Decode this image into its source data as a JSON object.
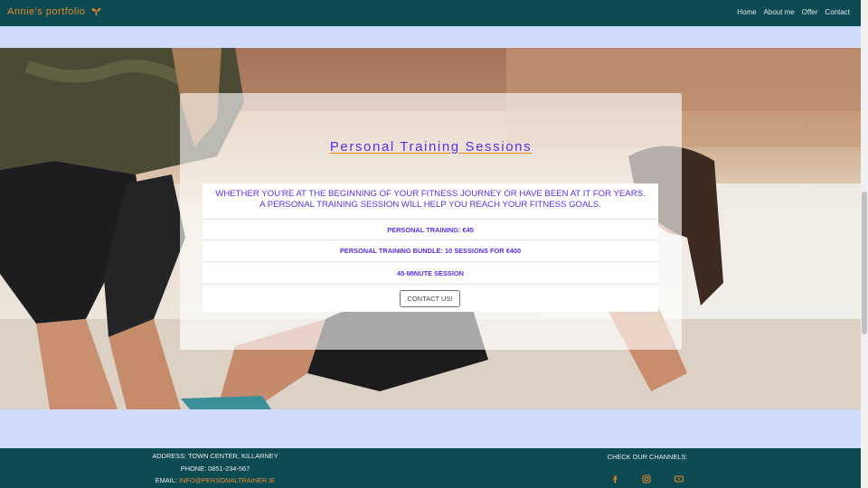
{
  "navbar": {
    "brand": "Annie's portfolio",
    "brand_icon": "seedling-icon",
    "links": [
      "Home",
      "About me",
      "Offer",
      "Contact"
    ]
  },
  "hero": {
    "image": "two-women-stretching-outdoors-photo",
    "title": "Personal Training Sessions",
    "intro": "Whether you're at the beginning of your fitness journey or have been at it for years. A personal training session will help you reach your fitness goals.",
    "items": [
      "PERSONAL TRAINING: €45",
      "PERSONAL TRAINING BUNDLE: 10 SESSIONS FOR €400",
      "45-MINUTE SESSION"
    ],
    "cta": "CONTACT US!"
  },
  "footer": {
    "address": "Address: Town Center, Killarney",
    "phone": "Phone: 0851-234-567",
    "email_label": "Email:",
    "email": "info@personaltrainer.ie",
    "channels_label": "CHECK OUR CHANNELS:",
    "social_icons": [
      "facebook-icon",
      "instagram-icon",
      "youtube-icon"
    ]
  },
  "colors": {
    "navbar_bg": "#0e4a52",
    "accent_orange": "#e4882e",
    "text_purple": "#5b2ee6",
    "page_bg": "#cfdcfb"
  }
}
